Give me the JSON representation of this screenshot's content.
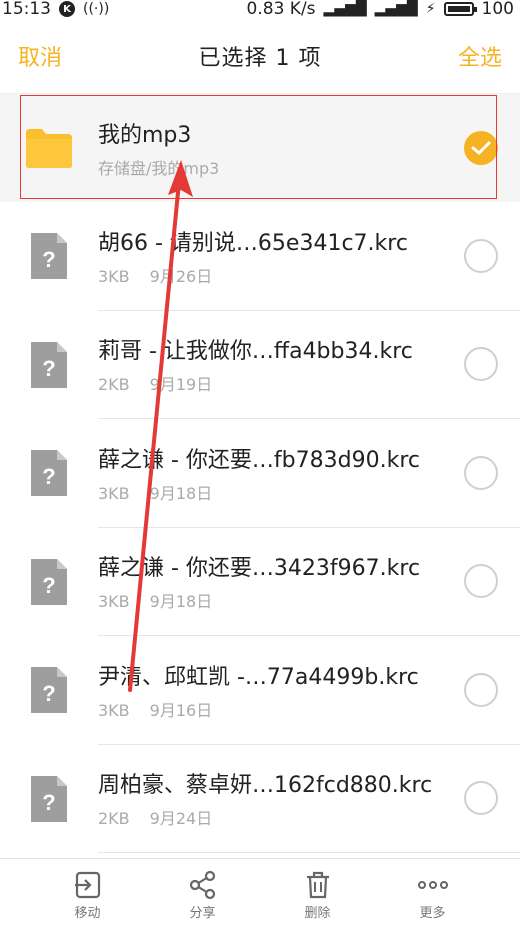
{
  "status_bar": {
    "time": "15:13",
    "speed": "0.83 K/s",
    "battery": "100"
  },
  "header": {
    "cancel": "取消",
    "title": "已选择 1 项",
    "select_all": "全选"
  },
  "files": [
    {
      "name": "我的mp3",
      "path": "存储盘/我的mp3",
      "type": "folder",
      "selected": true
    },
    {
      "name": "胡66 - 请别说…65e341c7.krc",
      "size": "3KB",
      "date": "9月26日",
      "type": "unknown",
      "selected": false
    },
    {
      "name": "莉哥 - 让我做你…ffa4bb34.krc",
      "size": "2KB",
      "date": "9月19日",
      "type": "unknown",
      "selected": false
    },
    {
      "name": "薛之谦 - 你还要…fb783d90.krc",
      "size": "3KB",
      "date": "9月18日",
      "type": "unknown",
      "selected": false
    },
    {
      "name": "薛之谦 - 你还要…3423f967.krc",
      "size": "3KB",
      "date": "9月18日",
      "type": "unknown",
      "selected": false
    },
    {
      "name": "尹清、邱虹凯 -…77a4499b.krc",
      "size": "3KB",
      "date": "9月16日",
      "type": "unknown",
      "selected": false
    },
    {
      "name": "周柏豪、蔡卓妍…162fcd880.krc",
      "size": "2KB",
      "date": "9月24日",
      "type": "unknown",
      "selected": false
    }
  ],
  "toolbar": {
    "move": "移动",
    "share": "分享",
    "delete": "删除",
    "more": "更多"
  },
  "colors": {
    "accent": "#f5b324",
    "folder": "#fbbe2e",
    "annotation": "#e53935"
  }
}
